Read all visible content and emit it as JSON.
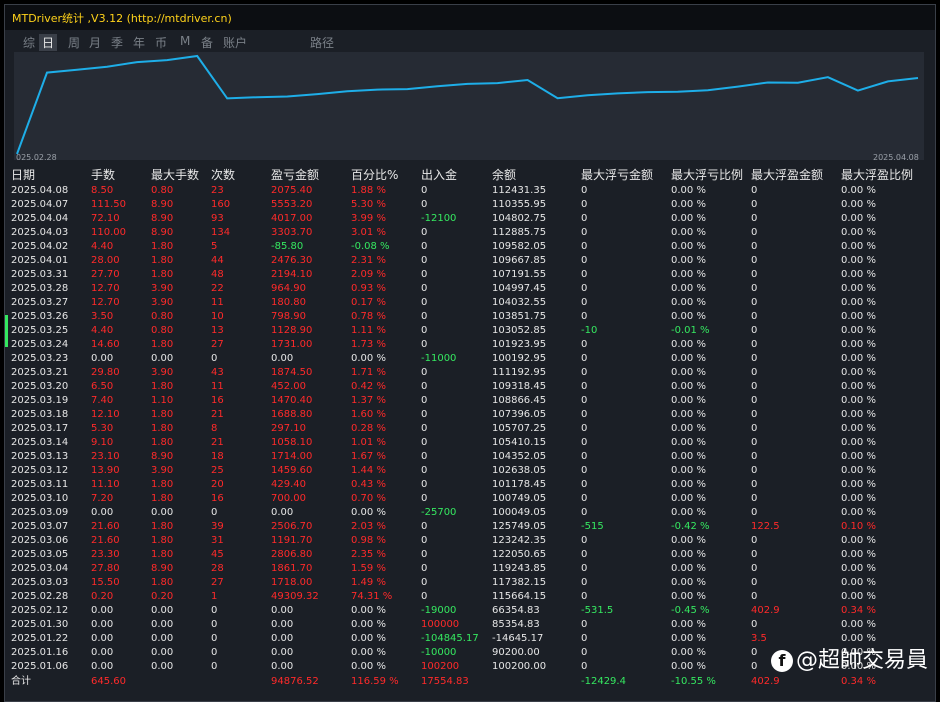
{
  "window": {
    "title": "MTDriver统计 ,V3.12 (http://mtdriver.cn)"
  },
  "tabs": [
    {
      "label": "综",
      "active": false
    },
    {
      "label": "日",
      "active": true
    },
    {
      "label": "周",
      "active": false
    },
    {
      "label": "月",
      "active": false
    },
    {
      "label": "季",
      "active": false
    },
    {
      "label": "年",
      "active": false
    },
    {
      "label": "币",
      "active": false
    },
    {
      "label": "M",
      "active": false
    },
    {
      "label": "备",
      "active": false
    },
    {
      "label": "账户",
      "active": false
    },
    {
      "label": "路径",
      "active": false
    }
  ],
  "chart_data": {
    "type": "line",
    "x_start_label": "025.02.28",
    "x_end_label": "2025.04.08",
    "line_color": "#1eaee8",
    "x": [
      "2025.01.06",
      "2025.01.16",
      "2025.01.22",
      "2025.01.30",
      "2025.02.12",
      "2025.02.28",
      "2025.03.03",
      "2025.03.04",
      "2025.03.05",
      "2025.03.06",
      "2025.03.07",
      "2025.03.09",
      "2025.03.10",
      "2025.03.11",
      "2025.03.12",
      "2025.03.13",
      "2025.03.14",
      "2025.03.17",
      "2025.03.18",
      "2025.03.19",
      "2025.03.20",
      "2025.03.21",
      "2025.03.23",
      "2025.03.24",
      "2025.03.25",
      "2025.03.26",
      "2025.03.27",
      "2025.03.28",
      "2025.03.31",
      "2025.04.01",
      "2025.04.02",
      "2025.04.03",
      "2025.04.04",
      "2025.04.07",
      "2025.04.08"
    ],
    "values": [
      100200.0,
      90200.0,
      -14645.17,
      85354.83,
      66354.83,
      115664.15,
      117382.15,
      119243.85,
      122050.65,
      123242.35,
      125749.05,
      100049.05,
      100749.05,
      101178.45,
      102638.05,
      104352.05,
      105410.15,
      105707.25,
      107396.05,
      108866.45,
      109318.45,
      111192.95,
      100192.95,
      101923.95,
      103052.85,
      103851.75,
      104032.55,
      104997.45,
      107191.55,
      109667.85,
      109582.05,
      112885.75,
      104802.75,
      110355.95,
      112431.35
    ],
    "note_visible_window": "curve drawn starts at 2025.02.28 and ends at 2025.04.08"
  },
  "table": {
    "headers": [
      "日期",
      "手数",
      "最大手数",
      "次数",
      "盈亏金额",
      "百分比%",
      "出入金",
      "余额",
      "最大浮亏金额",
      "最大浮亏比例",
      "最大浮盈金额",
      "最大浮盈比例"
    ],
    "rows": [
      [
        "2025.04.08",
        "8.50",
        "0.80",
        "23",
        "2075.40",
        "1.88 %",
        "0",
        "112431.35",
        "0",
        "0.00 %",
        "0",
        "0.00 %"
      ],
      [
        "2025.04.07",
        "111.50",
        "8.90",
        "160",
        "5553.20",
        "5.30 %",
        "0",
        "110355.95",
        "0",
        "0.00 %",
        "0",
        "0.00 %"
      ],
      [
        "2025.04.04",
        "72.10",
        "8.90",
        "93",
        "4017.00",
        "3.99 %",
        "-12100",
        "104802.75",
        "0",
        "0.00 %",
        "0",
        "0.00 %"
      ],
      [
        "2025.04.03",
        "110.00",
        "8.90",
        "134",
        "3303.70",
        "3.01 %",
        "0",
        "112885.75",
        "0",
        "0.00 %",
        "0",
        "0.00 %"
      ],
      [
        "2025.04.02",
        "4.40",
        "1.80",
        "5",
        "-85.80",
        "-0.08 %",
        "0",
        "109582.05",
        "0",
        "0.00 %",
        "0",
        "0.00 %"
      ],
      [
        "2025.04.01",
        "28.00",
        "1.80",
        "44",
        "2476.30",
        "2.31 %",
        "0",
        "109667.85",
        "0",
        "0.00 %",
        "0",
        "0.00 %"
      ],
      [
        "2025.03.31",
        "27.70",
        "1.80",
        "48",
        "2194.10",
        "2.09 %",
        "0",
        "107191.55",
        "0",
        "0.00 %",
        "0",
        "0.00 %"
      ],
      [
        "2025.03.28",
        "12.70",
        "3.90",
        "22",
        "964.90",
        "0.93 %",
        "0",
        "104997.45",
        "0",
        "0.00 %",
        "0",
        "0.00 %"
      ],
      [
        "2025.03.27",
        "12.70",
        "3.90",
        "11",
        "180.80",
        "0.17 %",
        "0",
        "104032.55",
        "0",
        "0.00 %",
        "0",
        "0.00 %"
      ],
      [
        "2025.03.26",
        "3.50",
        "0.80",
        "10",
        "798.90",
        "0.78 %",
        "0",
        "103851.75",
        "0",
        "0.00 %",
        "0",
        "0.00 %"
      ],
      [
        "2025.03.25",
        "4.40",
        "0.80",
        "13",
        "1128.90",
        "1.11 %",
        "0",
        "103052.85",
        "-10",
        "-0.01 %",
        "0",
        "0.00 %"
      ],
      [
        "2025.03.24",
        "14.60",
        "1.80",
        "27",
        "1731.00",
        "1.73 %",
        "0",
        "101923.95",
        "0",
        "0.00 %",
        "0",
        "0.00 %"
      ],
      [
        "2025.03.23",
        "0.00",
        "0.00",
        "0",
        "0.00",
        "0.00 %",
        "-11000",
        "100192.95",
        "0",
        "0.00 %",
        "0",
        "0.00 %"
      ],
      [
        "2025.03.21",
        "29.80",
        "3.90",
        "43",
        "1874.50",
        "1.71 %",
        "0",
        "111192.95",
        "0",
        "0.00 %",
        "0",
        "0.00 %"
      ],
      [
        "2025.03.20",
        "6.50",
        "1.80",
        "11",
        "452.00",
        "0.42 %",
        "0",
        "109318.45",
        "0",
        "0.00 %",
        "0",
        "0.00 %"
      ],
      [
        "2025.03.19",
        "7.40",
        "1.10",
        "16",
        "1470.40",
        "1.37 %",
        "0",
        "108866.45",
        "0",
        "0.00 %",
        "0",
        "0.00 %"
      ],
      [
        "2025.03.18",
        "12.10",
        "1.80",
        "21",
        "1688.80",
        "1.60 %",
        "0",
        "107396.05",
        "0",
        "0.00 %",
        "0",
        "0.00 %"
      ],
      [
        "2025.03.17",
        "5.30",
        "1.80",
        "8",
        "297.10",
        "0.28 %",
        "0",
        "105707.25",
        "0",
        "0.00 %",
        "0",
        "0.00 %"
      ],
      [
        "2025.03.14",
        "9.10",
        "1.80",
        "21",
        "1058.10",
        "1.01 %",
        "0",
        "105410.15",
        "0",
        "0.00 %",
        "0",
        "0.00 %"
      ],
      [
        "2025.03.13",
        "23.10",
        "8.90",
        "18",
        "1714.00",
        "1.67 %",
        "0",
        "104352.05",
        "0",
        "0.00 %",
        "0",
        "0.00 %"
      ],
      [
        "2025.03.12",
        "13.90",
        "3.90",
        "25",
        "1459.60",
        "1.44 %",
        "0",
        "102638.05",
        "0",
        "0.00 %",
        "0",
        "0.00 %"
      ],
      [
        "2025.03.11",
        "11.10",
        "1.80",
        "20",
        "429.40",
        "0.43 %",
        "0",
        "101178.45",
        "0",
        "0.00 %",
        "0",
        "0.00 %"
      ],
      [
        "2025.03.10",
        "7.20",
        "1.80",
        "16",
        "700.00",
        "0.70 %",
        "0",
        "100749.05",
        "0",
        "0.00 %",
        "0",
        "0.00 %"
      ],
      [
        "2025.03.09",
        "0.00",
        "0.00",
        "0",
        "0.00",
        "0.00 %",
        "-25700",
        "100049.05",
        "0",
        "0.00 %",
        "0",
        "0.00 %"
      ],
      [
        "2025.03.07",
        "21.60",
        "1.80",
        "39",
        "2506.70",
        "2.03 %",
        "0",
        "125749.05",
        "-515",
        "-0.42 %",
        "122.5",
        "0.10 %"
      ],
      [
        "2025.03.06",
        "21.60",
        "1.80",
        "31",
        "1191.70",
        "0.98 %",
        "0",
        "123242.35",
        "0",
        "0.00 %",
        "0",
        "0.00 %"
      ],
      [
        "2025.03.05",
        "23.30",
        "1.80",
        "45",
        "2806.80",
        "2.35 %",
        "0",
        "122050.65",
        "0",
        "0.00 %",
        "0",
        "0.00 %"
      ],
      [
        "2025.03.04",
        "27.80",
        "8.90",
        "28",
        "1861.70",
        "1.59 %",
        "0",
        "119243.85",
        "0",
        "0.00 %",
        "0",
        "0.00 %"
      ],
      [
        "2025.03.03",
        "15.50",
        "1.80",
        "27",
        "1718.00",
        "1.49 %",
        "0",
        "117382.15",
        "0",
        "0.00 %",
        "0",
        "0.00 %"
      ],
      [
        "2025.02.28",
        "0.20",
        "0.20",
        "1",
        "49309.32",
        "74.31 %",
        "0",
        "115664.15",
        "0",
        "0.00 %",
        "0",
        "0.00 %"
      ],
      [
        "2025.02.12",
        "0.00",
        "0.00",
        "0",
        "0.00",
        "0.00 %",
        "-19000",
        "66354.83",
        "-531.5",
        "-0.45 %",
        "402.9",
        "0.34 %"
      ],
      [
        "2025.01.30",
        "0.00",
        "0.00",
        "0",
        "0.00",
        "0.00 %",
        "100000",
        "85354.83",
        "0",
        "0.00 %",
        "0",
        "0.00 %"
      ],
      [
        "2025.01.22",
        "0.00",
        "0.00",
        "0",
        "0.00",
        "0.00 %",
        "-104845.17",
        "-14645.17",
        "0",
        "0.00 %",
        "3.5",
        "0.00 %"
      ],
      [
        "2025.01.16",
        "0.00",
        "0.00",
        "0",
        "0.00",
        "0.00 %",
        "-10000",
        "90200.00",
        "0",
        "0.00 %",
        "0",
        "0.00 %"
      ],
      [
        "2025.01.06",
        "0.00",
        "0.00",
        "0",
        "0.00",
        "0.00 %",
        "100200",
        "100200.00",
        "0",
        "0.00 %",
        "0",
        "0.00 %"
      ]
    ],
    "total": [
      "合计",
      "645.60",
      "",
      "",
      "94876.52",
      "116.59 %",
      "17554.83",
      "",
      "-12429.4",
      "-10.55 %",
      "402.9",
      "0.34 %"
    ]
  },
  "colors": {
    "negative_red": "#ff2a2a",
    "positive_green": "#35e860",
    "title_yellow": "#ffd21a",
    "curve_blue": "#1eaee8"
  },
  "watermark": {
    "text": "@超帥交易員",
    "logo_letter": "f"
  }
}
